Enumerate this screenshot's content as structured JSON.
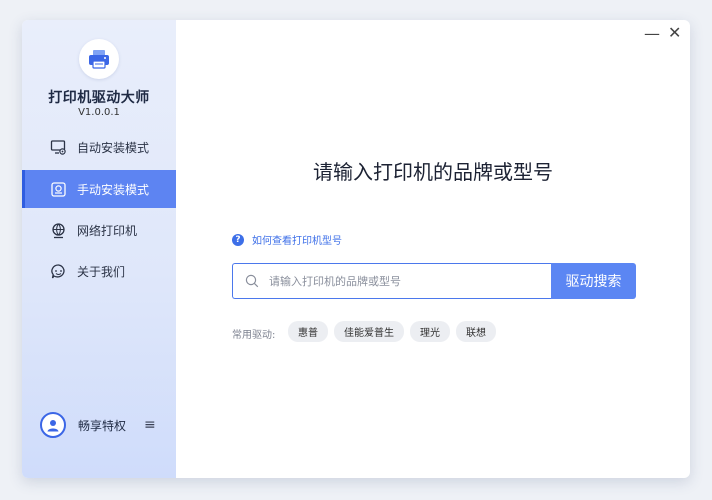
{
  "window": {
    "minimize_symbol": "—",
    "close_symbol": "✕"
  },
  "sidebar": {
    "app_title": "打印机驱动大师",
    "version": "V1.0.0.1",
    "logo_icon": "printer-icon",
    "items": [
      {
        "label": "自动安装模式",
        "icon": "monitor-gear-icon",
        "active": false
      },
      {
        "label": "手动安装模式",
        "icon": "manual-install-icon",
        "active": true
      },
      {
        "label": "网络打印机",
        "icon": "network-icon",
        "active": false
      },
      {
        "label": "关于我们",
        "icon": "info-chat-icon",
        "active": false
      }
    ],
    "user": {
      "name": "畅享特权",
      "menu_symbol": "≡"
    }
  },
  "main": {
    "title": "请输入打印机的品牌或型号",
    "help_link": "如何查看打印机型号",
    "search": {
      "placeholder": "请输入打印机的品牌或型号",
      "button_label": "驱动搜索"
    },
    "common_label": "常用驱动:",
    "tags": [
      "惠普",
      "佳能爱普生",
      "理光",
      "联想"
    ]
  },
  "colors": {
    "accent": "#5b86f3",
    "accent_dark": "#2f5de0",
    "link": "#3d6fe8",
    "sidebar_bg": "#e4eafb"
  }
}
